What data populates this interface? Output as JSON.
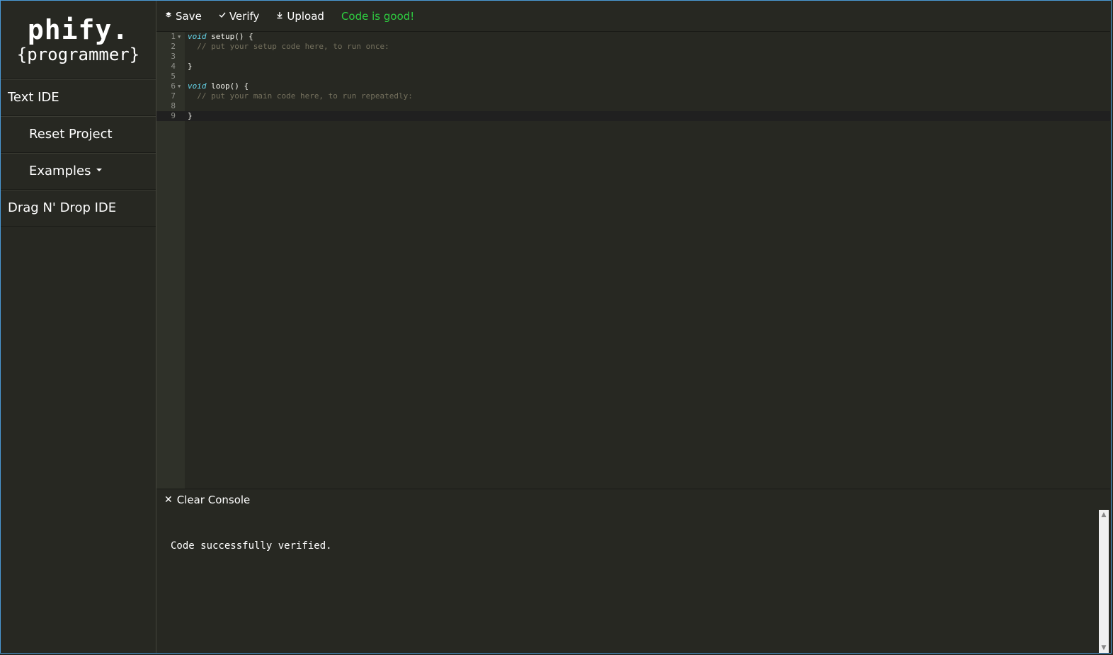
{
  "sidebar": {
    "logo_line1": "phify.",
    "logo_line2": "{programmer}",
    "items": [
      {
        "label": "Text IDE"
      },
      {
        "label": "Reset Project"
      },
      {
        "label": "Examples"
      },
      {
        "label": "Drag N' Drop IDE"
      }
    ]
  },
  "toolbar": {
    "save_label": "Save",
    "verify_label": "Verify",
    "upload_label": "Upload",
    "status": "Code is good!",
    "status_color": "#2ecc40"
  },
  "editor": {
    "lines": [
      {
        "n": "1",
        "fold": "▼",
        "kw": "void",
        "rest": " setup() {",
        "comment": ""
      },
      {
        "n": "2",
        "fold": "",
        "kw": "",
        "rest": "  ",
        "comment": "// put your setup code here, to run once:"
      },
      {
        "n": "3",
        "fold": "",
        "kw": "",
        "rest": "",
        "comment": ""
      },
      {
        "n": "4",
        "fold": "",
        "kw": "",
        "rest": "}",
        "comment": ""
      },
      {
        "n": "5",
        "fold": "",
        "kw": "",
        "rest": "",
        "comment": ""
      },
      {
        "n": "6",
        "fold": "▼",
        "kw": "void",
        "rest": " loop() {",
        "comment": ""
      },
      {
        "n": "7",
        "fold": "",
        "kw": "",
        "rest": "  ",
        "comment": "// put your main code here, to run repeatedly:"
      },
      {
        "n": "8",
        "fold": "",
        "kw": "",
        "rest": "",
        "comment": ""
      },
      {
        "n": "9",
        "fold": "",
        "kw": "",
        "rest": "}",
        "comment": ""
      }
    ]
  },
  "console": {
    "clear_label": "Clear Console",
    "message": "Code successfully verified."
  },
  "icons": {
    "save": "layers-icon",
    "verify": "check-icon",
    "upload": "download-icon",
    "clear": "close-icon"
  }
}
